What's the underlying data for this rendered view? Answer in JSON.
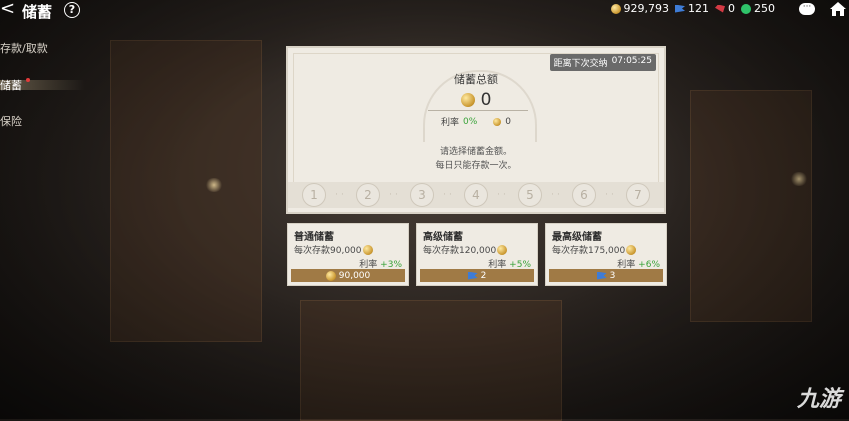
{
  "header": {
    "back_glyph": "<",
    "title": "储蓄",
    "help_glyph": "?"
  },
  "resources": [
    {
      "icon": "gold-coin-icon",
      "value": "929,793"
    },
    {
      "icon": "blue-flag-icon",
      "value": "121"
    },
    {
      "icon": "red-gem-icon",
      "value": "0"
    },
    {
      "icon": "green-gear-icon",
      "value": "250"
    }
  ],
  "sidebar": {
    "items": [
      {
        "label": "存款/取款"
      },
      {
        "label": "储蓄"
      },
      {
        "label": "保险"
      }
    ]
  },
  "panel": {
    "countdown_label": "距离下次交纳",
    "countdown_time": "07:05:25",
    "title": "储蓄总额",
    "total_value": "0",
    "rate_label": "利率",
    "rate_value": "0%",
    "rate_coin_value": "0",
    "hint_line1": "请选择储蓄金额。",
    "hint_line2": "每日只能存款一次。",
    "steps": [
      "1",
      "2",
      "3",
      "4",
      "5",
      "6",
      "7"
    ]
  },
  "options": [
    {
      "title": "普通储蓄",
      "desc": "每次存款90,000",
      "rate_label": "利率",
      "rate_bonus": "+3%",
      "cost_icon": "gold-coin-icon",
      "cost": "90,000"
    },
    {
      "title": "高级储蓄",
      "desc": "每次存款120,000",
      "rate_label": "利率",
      "rate_bonus": "+5%",
      "cost_icon": "blue-flag-icon",
      "cost": "2"
    },
    {
      "title": "最高级储蓄",
      "desc": "每次存款175,000",
      "rate_label": "利率",
      "rate_bonus": "+6%",
      "cost_icon": "blue-flag-icon",
      "cost": "3"
    }
  ],
  "watermark": "九游",
  "colors": {
    "accent_green": "#3aa33a",
    "button_brown": "#a07a45"
  }
}
